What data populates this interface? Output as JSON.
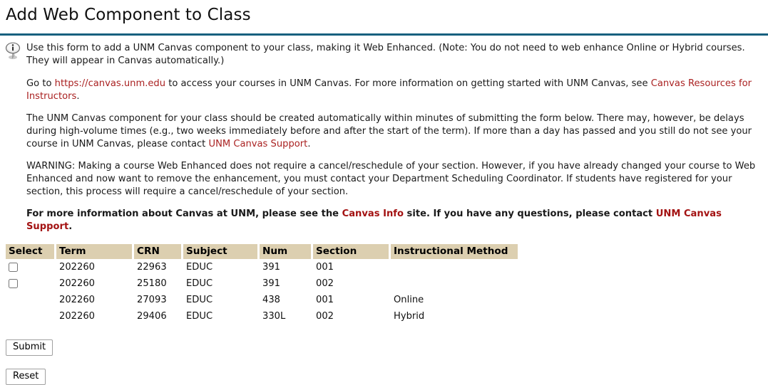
{
  "page": {
    "title": "Add Web Component to Class",
    "rule_color": "#16607f"
  },
  "info": {
    "icon": "info-balloon-icon",
    "paragraph1": {
      "text": "Use this form to add a UNM Canvas component to your class, making it Web Enhanced. (Note: You do not need to web enhance Online or Hybrid courses. They will appear in Canvas automatically.)"
    },
    "paragraph2": {
      "prefix": "Go to ",
      "link1": "https://canvas.unm.edu",
      "middle": " to access your courses in UNM Canvas. For more information on getting started with UNM Canvas, see ",
      "link2": "Canvas Resources for Instructors",
      "suffix": "."
    },
    "paragraph3": {
      "prefix": "The UNM Canvas component for your class should be created automatically within minutes of submitting the form below. There may, however, be delays during high-volume times (e.g., two weeks immediately before and after the start of the term). If more than a day has passed and you still do not see your course in UNM Canvas, please contact ",
      "link": "UNM Canvas Support",
      "suffix": "."
    },
    "paragraph4": {
      "text": "WARNING: Making a course Web Enhanced does not require a cancel/reschedule of your section. However, if you have already changed your course to Web Enhanced and now want to remove the enhancement, you must contact your Department Scheduling Coordinator. If students have registered for your section, this process will require a cancel/reschedule of your section."
    },
    "paragraph5": {
      "prefix": "For more information about Canvas at UNM, please see the ",
      "link1": "Canvas Info",
      "middle": " site. If you have any questions, please contact ",
      "link2": "UNM Canvas Support",
      "suffix": "."
    },
    "link_color": "#aa2222"
  },
  "table": {
    "headers": [
      "Select",
      "Term",
      "CRN",
      "Subject",
      "Num",
      "Section",
      "Instructional Method"
    ],
    "header_bg": "#dccfb0",
    "rows": [
      {
        "selectable": true,
        "checked": false,
        "term": "202260",
        "crn": "22963",
        "subject": "EDUC",
        "num": "391",
        "section": "001",
        "method": ""
      },
      {
        "selectable": true,
        "checked": false,
        "term": "202260",
        "crn": "25180",
        "subject": "EDUC",
        "num": "391",
        "section": "002",
        "method": ""
      },
      {
        "selectable": false,
        "checked": false,
        "term": "202260",
        "crn": "27093",
        "subject": "EDUC",
        "num": "438",
        "section": "001",
        "method": "Online"
      },
      {
        "selectable": false,
        "checked": false,
        "term": "202260",
        "crn": "29406",
        "subject": "EDUC",
        "num": "330L",
        "section": "002",
        "method": "Hybrid"
      }
    ]
  },
  "buttons": {
    "submit": "Submit",
    "reset": "Reset"
  }
}
